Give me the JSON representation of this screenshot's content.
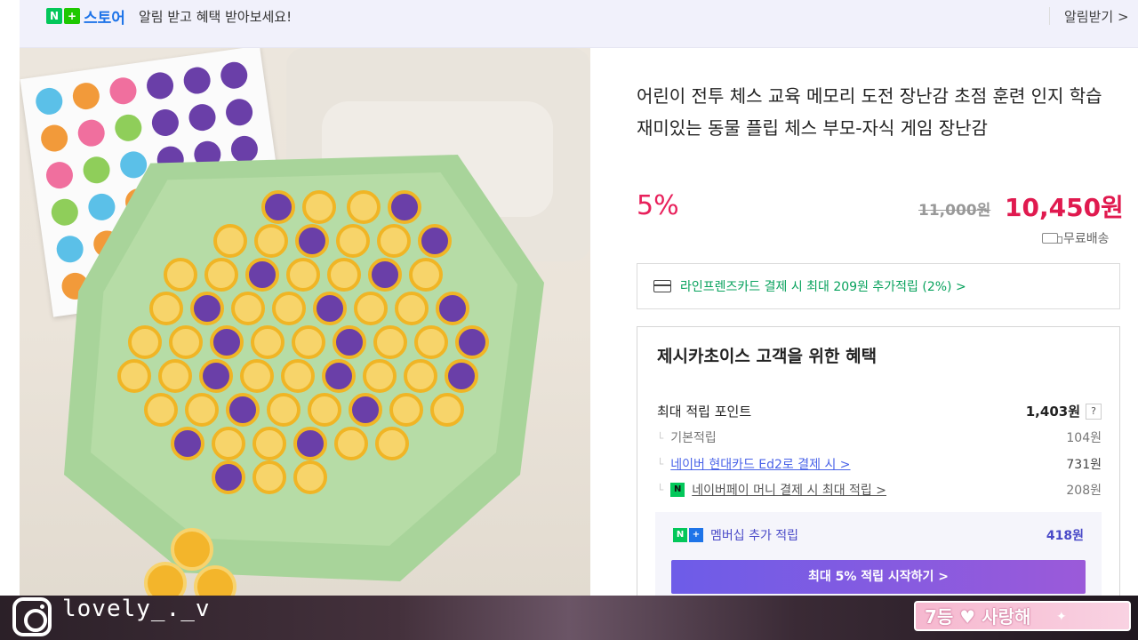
{
  "topbar": {
    "logo_n": "N",
    "logo_plus": "+",
    "store_label": "스토어",
    "message": "알림 받고 혜택 받아보세요!",
    "link": "알림받기 >"
  },
  "product": {
    "title": "어린이 전투 체스 교육 메모리 도전 장난감 초점 훈련 인지 학습 재미있는 동물 플립 체스 부모-자식 게임 장난감",
    "discount": "5%",
    "original_price": "11,000원",
    "price": "10,450원",
    "shipping": "무료배송"
  },
  "card_banner": {
    "text": "라인프렌즈카드 결제 시 최대 209원 추가적립 (2%) >"
  },
  "benefits": {
    "title": "제시카초이스 고객을 위한 혜택",
    "max_point_label": "최대 적립 포인트",
    "max_point_value": "1,403원",
    "help": "?",
    "basic_label": "기본적립",
    "basic_value": "104원",
    "card_label": "네이버 현대카드 Ed2로 결제 시 >",
    "card_value": "731원",
    "npay_badge": "N",
    "npay_label": "네이버페이 머니 결제 시 최대 적립 >",
    "npay_value": "208원",
    "membership_n": "N",
    "membership_plus": "+",
    "membership_label": "멤버십 추가 적립",
    "membership_value": "418원",
    "cta": "최대 5% 적립 시작하기 >"
  },
  "stream": {
    "handle": "lovely_._v",
    "rank": "7등 ♥ 사랑해",
    "sparkle": "✦"
  }
}
